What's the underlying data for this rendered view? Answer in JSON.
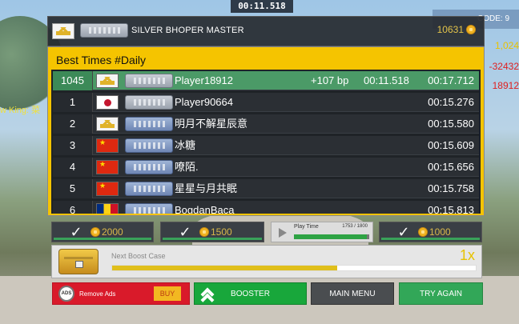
{
  "hud": {
    "timer": "00:11.518",
    "code_label": "CODE: 9",
    "side_values": [
      "1,024",
      "-32432",
      "18912"
    ],
    "king_label": "w King: 菜"
  },
  "top_bar": {
    "rank_title": "SILVER BHOPER MASTER",
    "coins": "10631"
  },
  "leaderboard": {
    "title": "Best Times #Daily",
    "rows": [
      {
        "rank": "1045",
        "flag": "crown",
        "badge": "silver",
        "name": "Player18912",
        "bp": "+107 bp",
        "time1": "00:11.518",
        "time2": "00:17.712",
        "self": true
      },
      {
        "rank": "1",
        "flag": "jp",
        "badge": "silver",
        "name": "Player90664",
        "bp": "",
        "time1": "",
        "time2": "00:15.276",
        "self": false
      },
      {
        "rank": "2",
        "flag": "crown",
        "badge": "blue",
        "name": "明月不解星辰意",
        "bp": "",
        "time1": "",
        "time2": "00:15.580",
        "self": false
      },
      {
        "rank": "3",
        "flag": "cn",
        "badge": "blue",
        "name": "冰糖",
        "bp": "",
        "time1": "",
        "time2": "00:15.609",
        "self": false
      },
      {
        "rank": "4",
        "flag": "cn",
        "badge": "blue",
        "name": "嘹陌.",
        "bp": "",
        "time1": "",
        "time2": "00:15.656",
        "self": false
      },
      {
        "rank": "5",
        "flag": "cn",
        "badge": "blue",
        "name": "星星与月共眠",
        "bp": "",
        "time1": "",
        "time2": "00:15.758",
        "self": false
      },
      {
        "rank": "6",
        "flag": "ro",
        "badge": "blue",
        "name": "BogdanBaca",
        "bp": "",
        "time1": "",
        "time2": "00:15.813",
        "self": false
      }
    ]
  },
  "stats": {
    "reward1": "2000",
    "reward2": "1500",
    "playtime_label": "Play Time",
    "playtime_value": "1753 / 1800",
    "playtime_progress": 0.97,
    "reward3": "1000"
  },
  "boost": {
    "label": "Next Boost Case",
    "multiplier": "1x",
    "progress": 0.62
  },
  "buttons": {
    "ads_icon": "ADS",
    "remove_ads": "Remove Ads",
    "buy": "BUY",
    "booster": "BOOSTER",
    "main_menu": "MAIN MENU",
    "try_again": "TRY AGAIN"
  },
  "colors": {
    "board_yellow": "#f5c400",
    "self_row": "#4b9a67",
    "ads_red": "#d91a2a",
    "booster_green": "#18a73b",
    "try_green": "#32a758"
  }
}
